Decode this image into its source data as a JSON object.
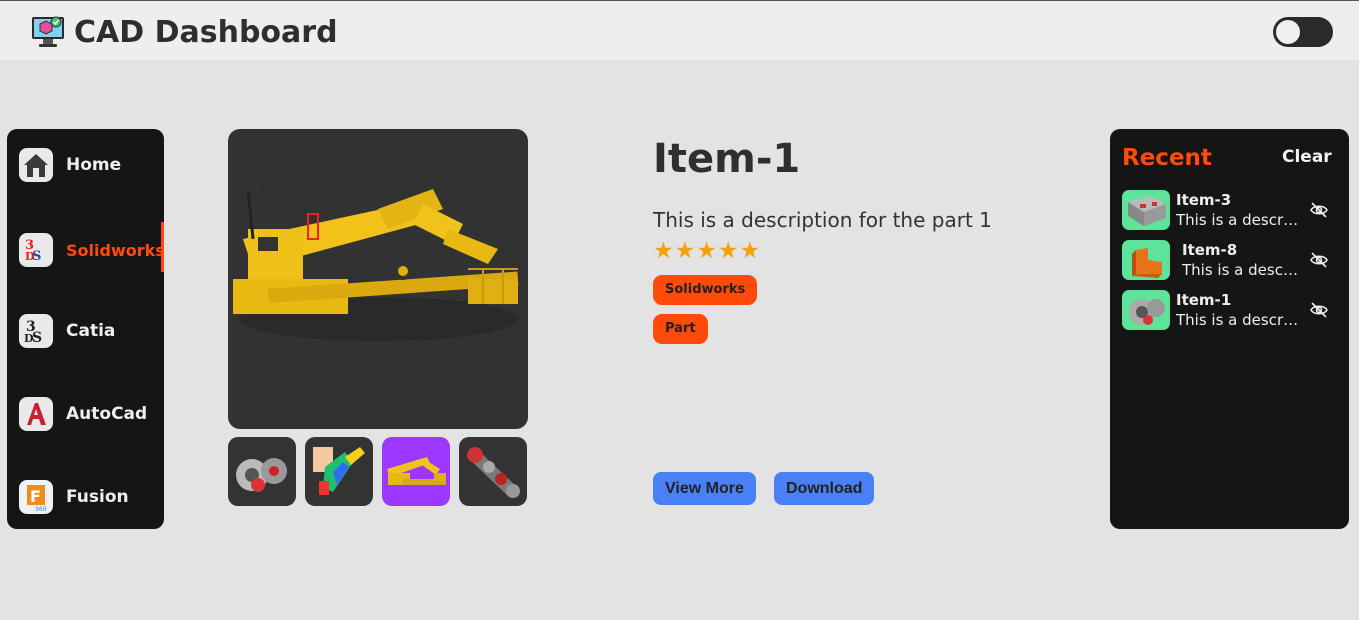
{
  "header": {
    "app_title": "CAD Dashboard",
    "logo_icon": "monitor-icon",
    "theme_toggle": "off"
  },
  "sidebar": {
    "items": [
      {
        "label": "Home",
        "icon": "home-icon",
        "active": false
      },
      {
        "label": "Solidworks",
        "icon": "solidworks-logo-icon",
        "active": true
      },
      {
        "label": "Catia",
        "icon": "catia-logo-icon",
        "active": false
      },
      {
        "label": "AutoCad",
        "icon": "autocad-logo-icon",
        "active": false
      },
      {
        "label": "Fusion",
        "icon": "fusion-logo-icon",
        "active": false
      }
    ]
  },
  "gallery": {
    "main_image": "yellow-crane-render",
    "thumbnails": [
      {
        "name": "gear-assembly-thumb",
        "selected": false
      },
      {
        "name": "robot-arm-stress-thumb",
        "selected": false
      },
      {
        "name": "crane-thumb",
        "selected": true
      },
      {
        "name": "drive-shaft-thumb",
        "selected": false
      }
    ]
  },
  "details": {
    "title": "Item-1",
    "description": "This is a description for the part 1",
    "rating": 5,
    "stars": [
      "★",
      "★",
      "★",
      "★",
      "★"
    ],
    "tags": [
      "Solidworks",
      "Part"
    ],
    "view_more_label": "View More",
    "download_label": "Download"
  },
  "recent": {
    "title": "Recent",
    "clear_label": "Clear",
    "items": [
      {
        "name": "Item-3",
        "description": "This is a descrip..."
      },
      {
        "name": "Item-8",
        "description": "This is a descri..."
      },
      {
        "name": "Item-1",
        "description": "This is a descrip..."
      }
    ]
  },
  "colors": {
    "accent": "#ff4a0a",
    "button": "#4a80f5",
    "panel": "#151515",
    "background": "#e3e3e3",
    "star": "#f5a211"
  }
}
